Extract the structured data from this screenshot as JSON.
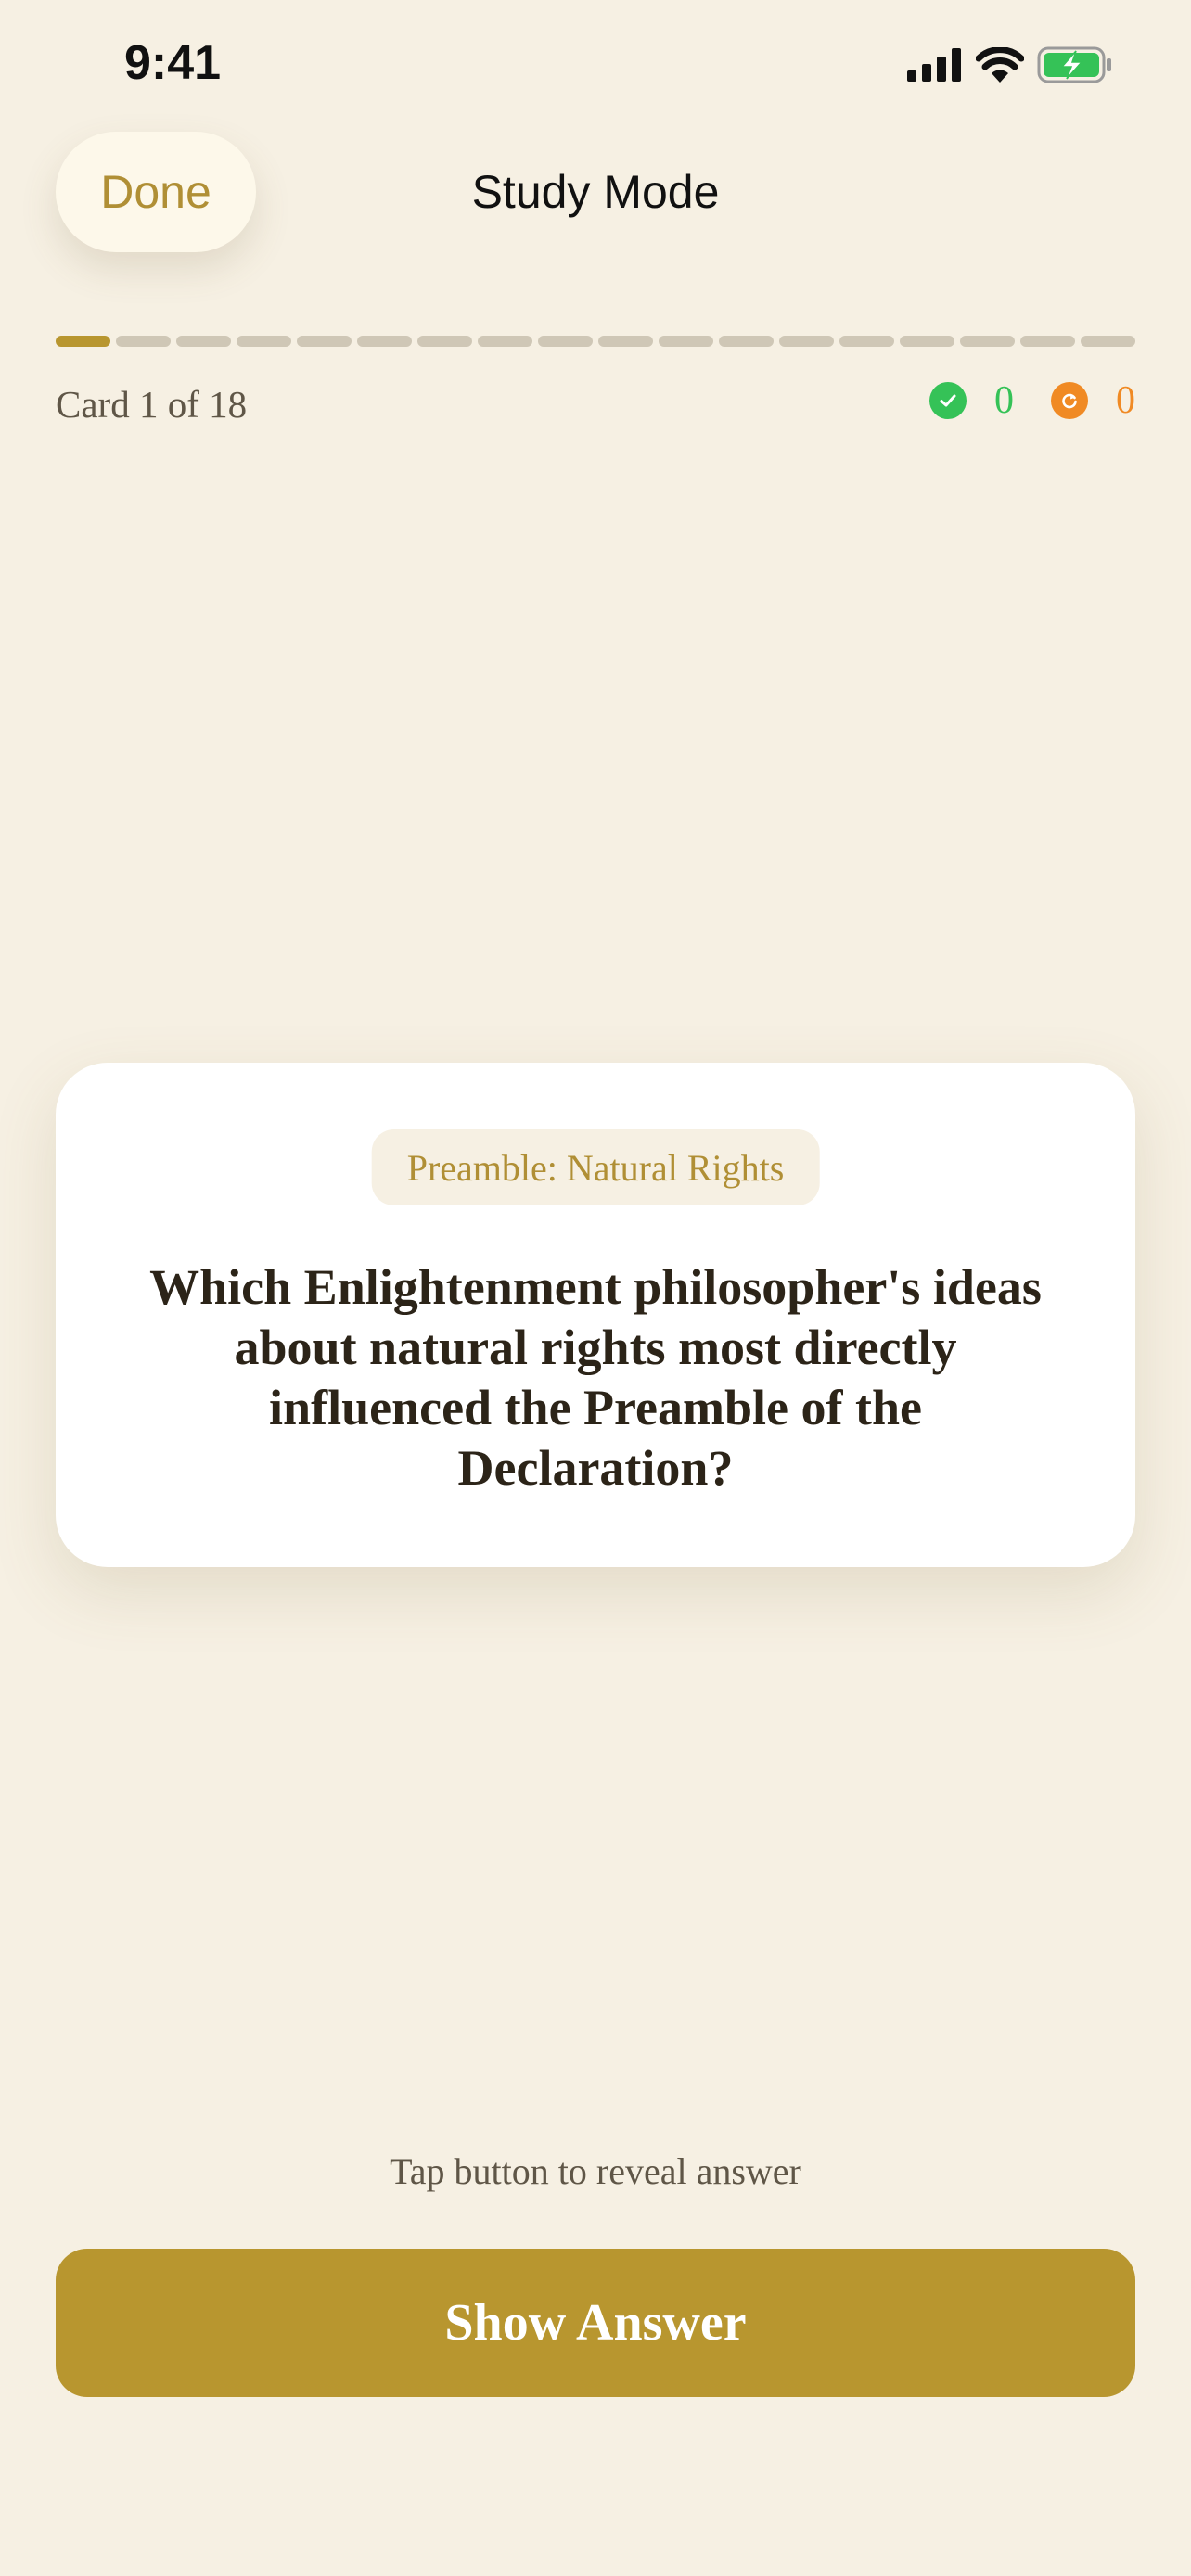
{
  "status_bar": {
    "time": "9:41",
    "icons": [
      "cellular-signal-icon",
      "wifi-icon",
      "battery-charging-icon"
    ]
  },
  "nav": {
    "done_label": "Done",
    "title": "Study Mode"
  },
  "progress": {
    "total_cards": 18,
    "current_card": 1,
    "label": "Card 1 of 18"
  },
  "stats": {
    "known": {
      "icon": "checkmark-circle-icon",
      "count": "0",
      "color": "#35C257"
    },
    "review": {
      "icon": "retry-circle-icon",
      "count": "0",
      "color": "#F08A24"
    }
  },
  "card": {
    "topic": "Preamble: Natural Rights",
    "question": "Which Enlightenment philosopher's ideas about natural rights most directly influenced the Preamble of the Declaration?"
  },
  "footer": {
    "hint": "Tap button to reveal answer",
    "show_answer_label": "Show Answer"
  },
  "colors": {
    "background": "#F6F0E3",
    "accent": "#B8962F",
    "card": "#FFFFFF",
    "text": "#2C2418"
  }
}
